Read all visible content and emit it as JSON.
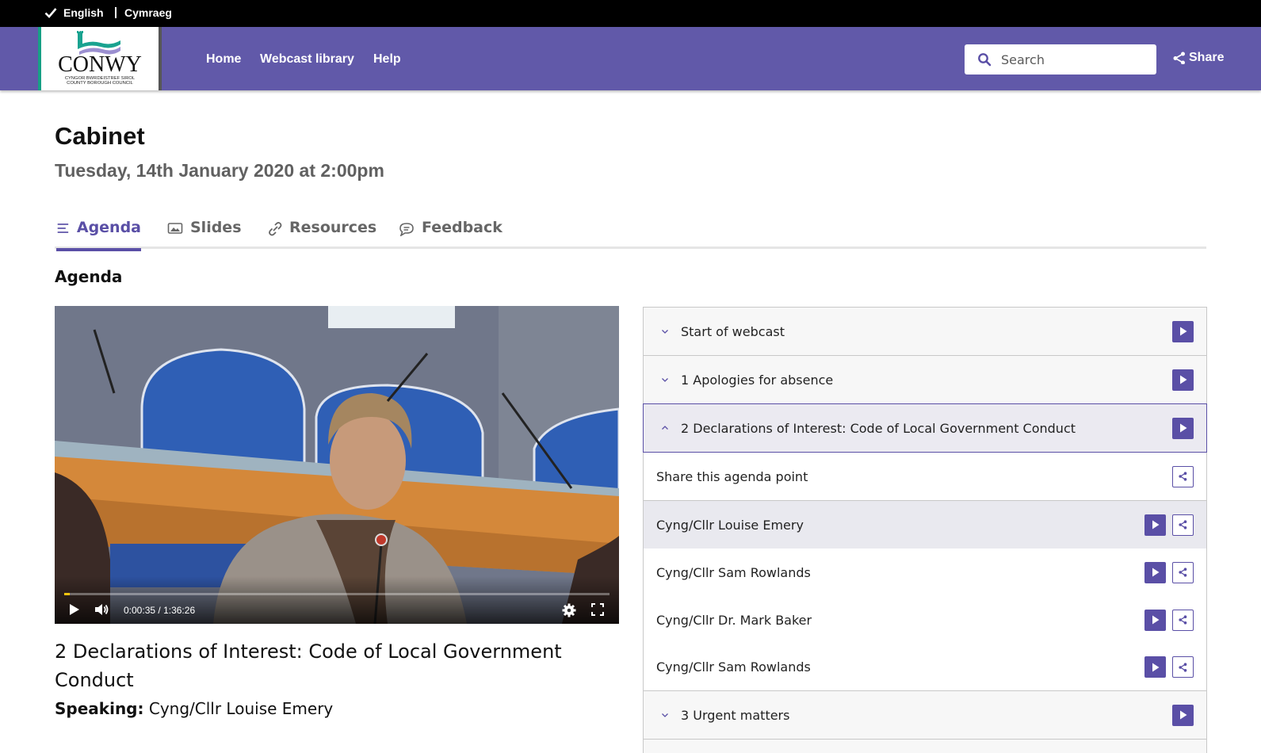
{
  "language_bar": {
    "english": "English",
    "welsh": "Cymraeg",
    "selected": "English"
  },
  "header": {
    "logo": {
      "name": "CONWY",
      "line1": "CYNGOR BWRDEISTREF SIROL",
      "line2": "COUNTY BOROUGH COUNCIL"
    },
    "nav": [
      {
        "label": "Home"
      },
      {
        "label": "Webcast library"
      },
      {
        "label": "Help"
      }
    ],
    "search": {
      "placeholder": "Search",
      "value": ""
    },
    "share_label": "Share",
    "brand_color": "#6159a9"
  },
  "page": {
    "title": "Cabinet",
    "date": "Tuesday, 14th January 2020 at 2:00pm"
  },
  "tabs": [
    {
      "label": "Agenda",
      "icon": "list-icon",
      "active": true
    },
    {
      "label": "Slides",
      "icon": "image-icon",
      "active": false
    },
    {
      "label": "Resources",
      "icon": "link-icon",
      "active": false
    },
    {
      "label": "Feedback",
      "icon": "speech-bubble-icon",
      "active": false
    }
  ],
  "section_heading": "Agenda",
  "video": {
    "current_time": "0:00:35",
    "separator": "/",
    "duration": "1:36:26",
    "progress_fraction": 0.006,
    "title": "2 Declarations of Interest: Code of Local Government Conduct",
    "speaking_label": "Speaking:",
    "speaking_name": "Cyng/Cllr Louise Emery"
  },
  "agenda": {
    "accent_color": "#5a4fa6",
    "items": [
      {
        "label": "Start of webcast",
        "expanded": false
      },
      {
        "label": "1 Apologies for absence",
        "expanded": false
      },
      {
        "label": "2 Declarations of Interest: Code of Local Government Conduct",
        "expanded": true
      },
      {
        "label": "3 Urgent matters",
        "expanded": false
      }
    ],
    "share_point_label": "Share this agenda point",
    "speakers": [
      {
        "name": "Cyng/Cllr Louise Emery",
        "current": true
      },
      {
        "name": "Cyng/Cllr Sam Rowlands",
        "current": false
      },
      {
        "name": "Cyng/Cllr Dr. Mark Baker",
        "current": false
      },
      {
        "name": "Cyng/Cllr Sam Rowlands",
        "current": false
      }
    ]
  }
}
